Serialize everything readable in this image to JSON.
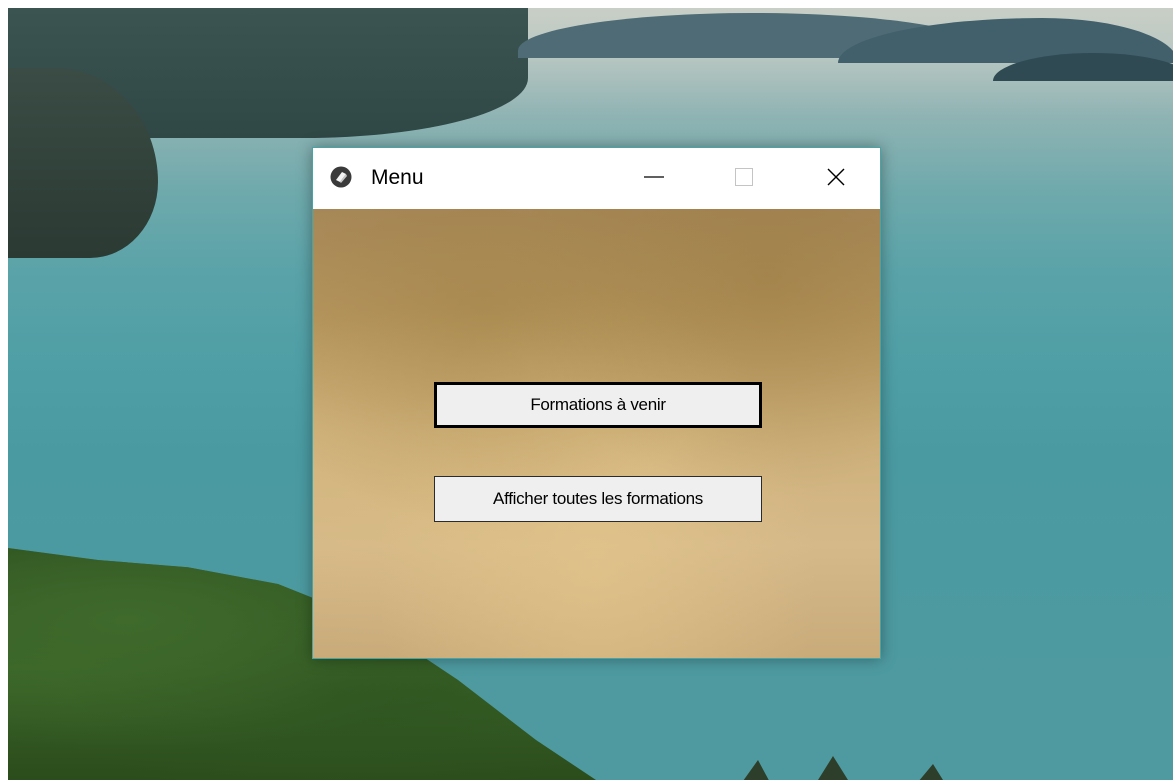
{
  "window": {
    "title": "Menu",
    "icon": "app-icon",
    "controls": {
      "minimize": "minimize-icon",
      "maximize": "maximize-icon",
      "close": "close-icon"
    }
  },
  "menu": {
    "upcoming_label": "Formations à venir",
    "all_label": "Afficher toutes les formations"
  },
  "colors": {
    "window_border": "#4aa3a5",
    "client_background": "#c9ab7a",
    "button_face": "#efefef"
  }
}
